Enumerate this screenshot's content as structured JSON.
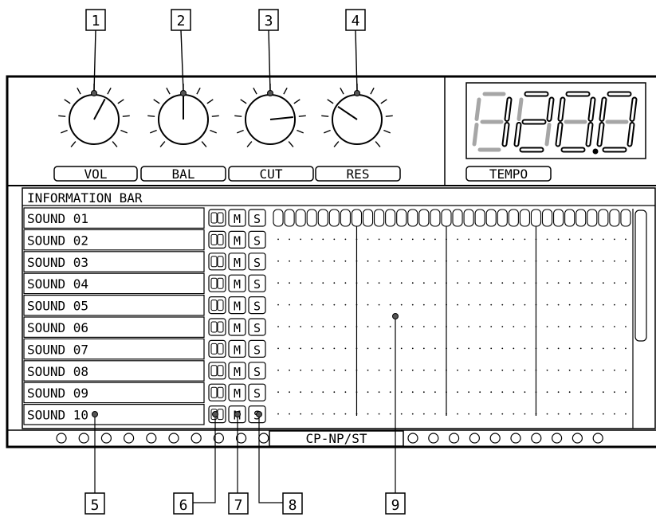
{
  "callouts": [
    "1",
    "2",
    "3",
    "4",
    "5",
    "6",
    "7",
    "8",
    "9"
  ],
  "knobs": [
    {
      "label": "VOL",
      "value": 0.6
    },
    {
      "label": "BAL",
      "value": 0.5
    },
    {
      "label": "CUT",
      "value": 0.8
    },
    {
      "label": "RES",
      "value": 0.3
    }
  ],
  "tempo": {
    "label": "TEMPO",
    "display": "120.0"
  },
  "info_bar": "INFORMATION BAR",
  "sounds": [
    "SOUND 01",
    "SOUND 02",
    "SOUND 03",
    "SOUND 04",
    "SOUND 05",
    "SOUND 06",
    "SOUND 07",
    "SOUND 08",
    "SOUND 09",
    "SOUND 10"
  ],
  "row_buttons": {
    "mute": "M",
    "solo": "S"
  },
  "mode_label": "CP-NP/ST",
  "steps": 32,
  "left_leds": 10,
  "right_leds": 10
}
